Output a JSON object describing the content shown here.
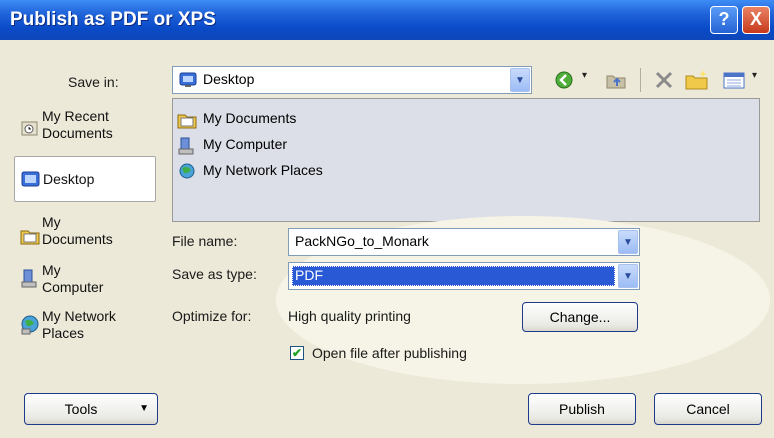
{
  "window": {
    "title": "Publish as PDF or XPS"
  },
  "titlebar_buttons": {
    "help": "?",
    "close": "X"
  },
  "save_in": {
    "label": "Save in:",
    "value": "Desktop"
  },
  "places": [
    {
      "line1": "My Recent",
      "line2": "Documents",
      "icon": "recent-documents-icon"
    },
    {
      "line1": "Desktop",
      "line2": "",
      "icon": "desktop-icon"
    },
    {
      "line1": "My",
      "line2": "Documents",
      "icon": "folder-icon"
    },
    {
      "line1": "My",
      "line2": "Computer",
      "icon": "computer-icon"
    },
    {
      "line1": "My Network",
      "line2": "Places",
      "icon": "network-places-icon"
    }
  ],
  "files": [
    {
      "name": "My Documents",
      "icon": "folder-icon"
    },
    {
      "name": "My Computer",
      "icon": "computer-icon"
    },
    {
      "name": "My Network Places",
      "icon": "network-places-icon"
    }
  ],
  "file_name": {
    "label": "File name:",
    "value": "PackNGo_to_Monark"
  },
  "save_as_type": {
    "label": "Save as type:",
    "value": "PDF"
  },
  "optimize": {
    "label": "Optimize for:",
    "value": "High quality printing",
    "button": "Change..."
  },
  "open_after": {
    "label": "Open file after publishing",
    "checked": true
  },
  "buttons": {
    "tools": "Tools",
    "publish": "Publish",
    "cancel": "Cancel"
  },
  "colors": {
    "titlebar": "#0a4bc8",
    "dialog": "#ece9d8",
    "selection": "#2a59d6"
  }
}
